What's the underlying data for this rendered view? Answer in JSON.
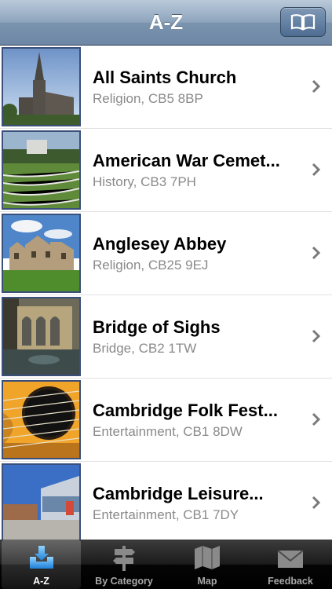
{
  "nav": {
    "title": "A-Z",
    "book_icon": "book-icon"
  },
  "items": [
    {
      "title": "All Saints Church",
      "subtitle": "Religion, CB5 8BP",
      "thumb": "church-photo"
    },
    {
      "title": "American War Cemet...",
      "subtitle": "History, CB3 7PH",
      "thumb": "cemetery-photo"
    },
    {
      "title": "Anglesey Abbey",
      "subtitle": "Religion, CB25 9EJ",
      "thumb": "abbey-photo"
    },
    {
      "title": "Bridge of Sighs",
      "subtitle": "Bridge, CB2 1TW",
      "thumb": "bridge-photo"
    },
    {
      "title": "Cambridge Folk Fest...",
      "subtitle": "Entertainment, CB1 8DW",
      "thumb": "guitar-photo"
    },
    {
      "title": "Cambridge Leisure...",
      "subtitle": "Entertainment, CB1 7DY",
      "thumb": "leisure-photo"
    }
  ],
  "tabs": [
    {
      "label": "A-Z",
      "icon": "download-tray-icon",
      "active": true
    },
    {
      "label": "By Category",
      "icon": "signpost-icon",
      "active": false
    },
    {
      "label": "Map",
      "icon": "map-icon",
      "active": false
    },
    {
      "label": "Feedback",
      "icon": "envelope-icon",
      "active": false
    }
  ],
  "colors": {
    "nav_blue": "#7a93ae",
    "thumb_border": "#3a4f7a",
    "subtitle_gray": "#8a8a8a"
  }
}
